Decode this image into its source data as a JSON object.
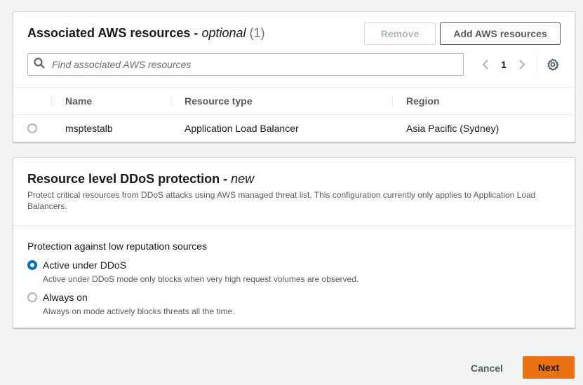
{
  "resources_panel": {
    "title": "Associated AWS resources -",
    "title_optional": "optional",
    "count": "(1)",
    "remove_label": "Remove",
    "add_label": "Add AWS resources",
    "search_placeholder": "Find associated AWS resources",
    "page_number": "1",
    "columns": [
      "Name",
      "Resource type",
      "Region"
    ],
    "rows": [
      {
        "name": "msptestalb",
        "type": "Application Load Balancer",
        "region": "Asia Pacific (Sydney)",
        "selected": false
      }
    ]
  },
  "ddos_panel": {
    "title": "Resource level DDoS protection -",
    "title_new": "new",
    "description": "Protect critical resources from DDoS attacks using AWS managed threat list. This configuration currently only applies to Application Load Balancers.",
    "field_label": "Protection against low reputation sources",
    "options": [
      {
        "title": "Active under DDoS",
        "description": "Active under DDoS mode only blocks when very high request volumes are observed.",
        "selected": true
      },
      {
        "title": "Always on",
        "description": "Always on mode actively blocks threats all the time.",
        "selected": false
      }
    ]
  },
  "footer": {
    "cancel_label": "Cancel",
    "next_label": "Next"
  },
  "colors": {
    "accent": "#0073bb",
    "primary_button": "#ec7211",
    "background": "#f2f3f3"
  }
}
